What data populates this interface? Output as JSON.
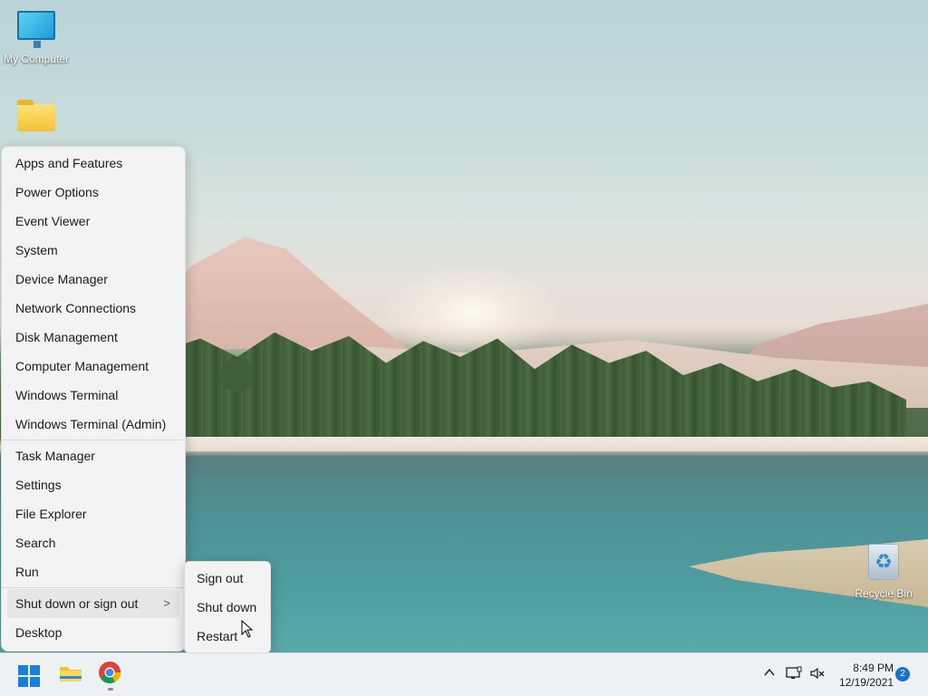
{
  "desktop": {
    "icons": [
      {
        "label": "My Computer",
        "icon": "monitor-icon"
      },
      {
        "label": "",
        "icon": "folder-icon"
      },
      {
        "label": "Recycle Bin",
        "icon": "recycle-bin-icon"
      }
    ]
  },
  "context_menu": {
    "group1": [
      "Apps and Features",
      "Power Options",
      "Event Viewer",
      "System",
      "Device Manager",
      "Network Connections",
      "Disk Management",
      "Computer Management",
      "Windows Terminal",
      "Windows Terminal (Admin)"
    ],
    "group2": [
      "Task Manager",
      "Settings",
      "File Explorer",
      "Search",
      "Run"
    ],
    "shutdown_label": "Shut down or sign out",
    "shutdown_chevron": ">",
    "desktop_label": "Desktop"
  },
  "submenu": {
    "items": [
      "Sign out",
      "Shut down",
      "Restart"
    ]
  },
  "taskbar": {
    "apps": [
      {
        "name": "start",
        "icon": "windows-start-icon"
      },
      {
        "name": "file-explorer",
        "icon": "folder-icon"
      },
      {
        "name": "chrome",
        "icon": "chrome-icon"
      }
    ],
    "tray": {
      "chevron": "^",
      "time": "8:49 PM",
      "date": "12/19/2021",
      "notification_count": "2"
    }
  },
  "colors": {
    "accent": "#1a7fd8",
    "menu_bg": "#f3f3f3",
    "taskbar_bg": "#eef1f4"
  }
}
